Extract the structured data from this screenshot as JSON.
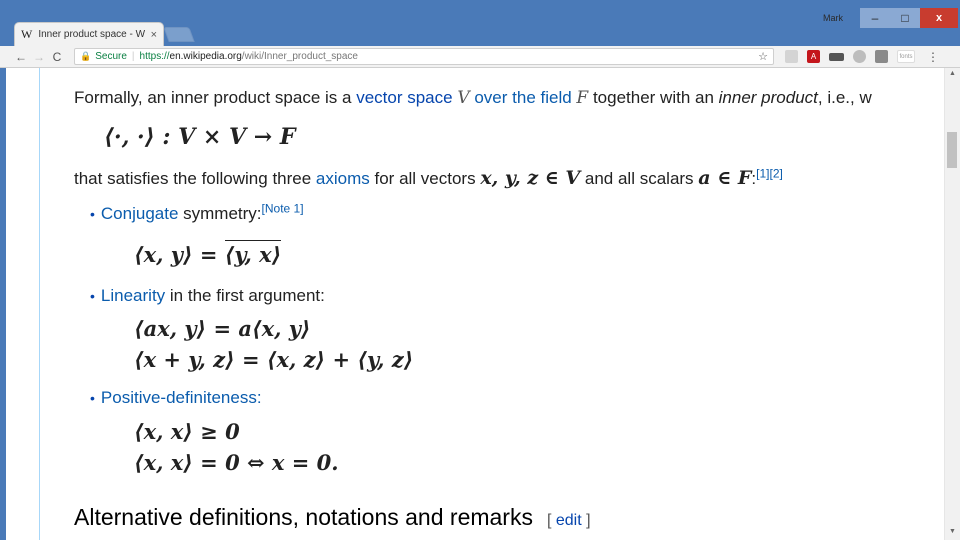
{
  "browser": {
    "tab_title": "Inner product space - Wi",
    "tab_favicon": "W",
    "tab_close": "×",
    "profile_name": "Mark",
    "minimize": "–",
    "maximize": "□",
    "close": "x",
    "back": "←",
    "forward": "→",
    "reload": "C",
    "secure_label": "Secure",
    "url_scheme": "https://",
    "url_host": "en.wikipedia.org",
    "url_path": "/wiki/Inner_product_space",
    "star": "☆",
    "ext_pdf": "A",
    "ext_fonts": "fonts",
    "menu": "⋮",
    "lock": "🔒"
  },
  "article": {
    "p1": {
      "t1": "Formally, an inner product space is a ",
      "link_vector_space": "vector space",
      "var_V": "V",
      "link_over_field": "over the field",
      "var_F": "F",
      "t2": " together with an ",
      "t_inner_product": "inner product",
      "t3": ", i.e., w"
    },
    "math_inner_product": "⟨·, ·⟩ : V × V → F",
    "p2": {
      "t1": "that satisfies the following three ",
      "link_axioms": "axioms",
      "t2": " for all vectors ",
      "math_xyz": "x, y, z ∈ V",
      "t3": " and all scalars ",
      "math_a": "a ∈ F",
      "t4": ":",
      "refs": "[1][2]"
    },
    "axioms": [
      {
        "link": "Conjugate",
        "rest": " symmetry:",
        "note": "[Note 1]",
        "formula_lhs": "⟨x, y⟩ = ",
        "formula_rhs": "⟨y, x⟩"
      },
      {
        "link": "Linearity",
        "rest": " in the first argument:",
        "formula_a": "⟨ax, y⟩ = a⟨x, y⟩",
        "formula_b": "⟨x + y, z⟩ = ⟨x, z⟩ + ⟨y, z⟩"
      },
      {
        "link": "Positive-definiteness",
        "rest": ":",
        "formula_a": "⟨x, x⟩ ≥ 0",
        "formula_b": "⟨x, x⟩ = 0 ⇔ x = 0."
      }
    ],
    "section_heading": "Alternative definitions, notations and remarks",
    "edit_open": "[ ",
    "edit_label": "edit",
    "edit_close": " ]"
  },
  "scrollbar": {
    "up": "▲",
    "down": "▼"
  },
  "colors": {
    "title_bar": "#4a7ab8",
    "link": "#0b5cad",
    "close_button": "#c83c2f"
  }
}
